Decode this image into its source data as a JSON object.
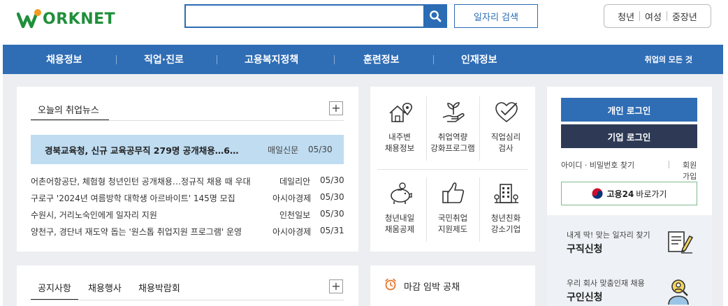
{
  "header": {
    "logo_text": "ORKNET",
    "search": {
      "placeholder": "",
      "value": ""
    },
    "job_search_label": "일자리 검색",
    "segments": [
      "청년",
      "여성",
      "중장년"
    ]
  },
  "nav": {
    "items": [
      "채용정보",
      "직업·진로",
      "고용복지정책",
      "훈련정보",
      "인재정보"
    ],
    "right_label": "취업의 모든 것"
  },
  "news": {
    "title": "오늘의 취업뉴스",
    "plus": "+",
    "featured": {
      "title": "경북교육청, 신규 교육공무직 279명 공개채용…6…",
      "source": "매일신문",
      "date": "05/30"
    },
    "items": [
      {
        "title": "어촌어항공단, 체험형 청년인턴 공개채용…정규직 채용 때 우대",
        "source": "데일리안",
        "date": "05/30"
      },
      {
        "title": "구로구 '2024년 여름방학 대학생 아르바이트' 145명 모집",
        "source": "아시아경제",
        "date": "05/30"
      },
      {
        "title": "수원시, 거리노숙인에게 일자리 지원",
        "source": "인천일보",
        "date": "05/30"
      },
      {
        "title": "양천구, 경단녀 재도약 돕는 '원스톱 취업지원 프로그램' 운영",
        "source": "아시아경제",
        "date": "05/31"
      }
    ]
  },
  "services": [
    {
      "line1": "내주변",
      "line2": "채용정보",
      "icon": "house-pin-icon"
    },
    {
      "line1": "취업역량",
      "line2": "강화프로그램",
      "icon": "sprout-hand-icon"
    },
    {
      "line1": "직업심리",
      "line2": "검사",
      "icon": "heart-check-icon"
    },
    {
      "line1": "청년내일",
      "line2": "채움공제",
      "icon": "piggy-bank-icon"
    },
    {
      "line1": "국민취업",
      "line2": "지원제도",
      "icon": "thumbs-up-icon"
    },
    {
      "line1": "청년친화",
      "line2": "강소기업",
      "icon": "building-icon"
    }
  ],
  "login": {
    "personal": "개인 로그인",
    "company": "기업 로그인",
    "find": "아이디 · 비밀번호 찾기",
    "join": "회원가입",
    "goyong24": {
      "brand": "고용24",
      "label": "바로가기"
    }
  },
  "side": {
    "job_request": {
      "sub": "내게 딱! 맞는 일자리 찾기",
      "title": "구직신청"
    },
    "hire_request": {
      "sub": "우리 회사 맞춤인재 채용",
      "title": "구인신청"
    }
  },
  "notice": {
    "tabs": [
      "공지사항",
      "채용행사",
      "채용박람회"
    ],
    "plus": "+"
  },
  "deadline": {
    "title": "마감 임박 공채"
  },
  "colors": {
    "primary": "#2f6db5",
    "dark": "#2e3a55",
    "highlight": "#bfdcf1",
    "logo_green": "#1f8f3a"
  }
}
